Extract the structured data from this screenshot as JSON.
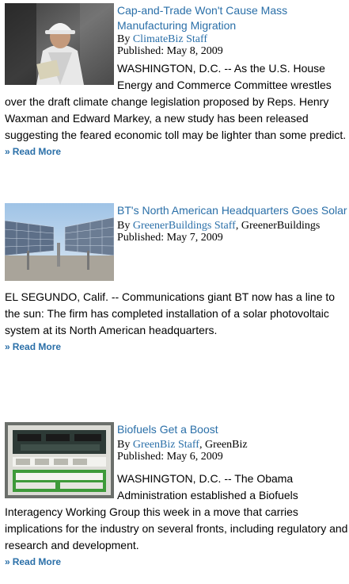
{
  "articles": [
    {
      "title": "Cap-and-Trade Won't Cause Mass Manufacturing Migration",
      "by_prefix": "By ",
      "author_link": "ClimateBiz Staff",
      "author_suffix": "",
      "published": "Published: May 8, 2009",
      "body": "WASHINGTON, D.C. -- As the U.S. House Energy and Commerce Committee wrestles over the draft climate change legislation proposed by Reps. Henry Waxman and Edward Markey, a new study has been released suggesting the feared economic toll may be lighter than some predict.",
      "read_more": "Read More",
      "image_icon": "hardhat-worker-photo"
    },
    {
      "title": "BT's North American Headquarters Goes Solar",
      "by_prefix": "By ",
      "author_link": "GreenerBuildings Staff",
      "author_suffix": ", GreenerBuildings",
      "published": "Published: May 7, 2009",
      "body": "EL SEGUNDO, Calif. -- Communications giant BT now has a line to the sun: The firm has completed installation of a solar photovoltaic system at its North American headquarters.",
      "read_more": "Read More",
      "image_icon": "solar-panels-photo"
    },
    {
      "title": "Biofuels Get a Boost",
      "by_prefix": "By ",
      "author_link": "GreenBiz Staff",
      "author_suffix": ", GreenBiz",
      "published": "Published: May 6, 2009",
      "body": "WASHINGTON, D.C. -- The Obama Administration established a Biofuels Interagency Working Group this week in a move that carries implications for the industry on several fronts, including regulatory and research and development.",
      "read_more": "Read More",
      "image_icon": "fuel-pump-photo"
    }
  ],
  "colors": {
    "link": "#2a6fa8",
    "text": "#000000"
  }
}
